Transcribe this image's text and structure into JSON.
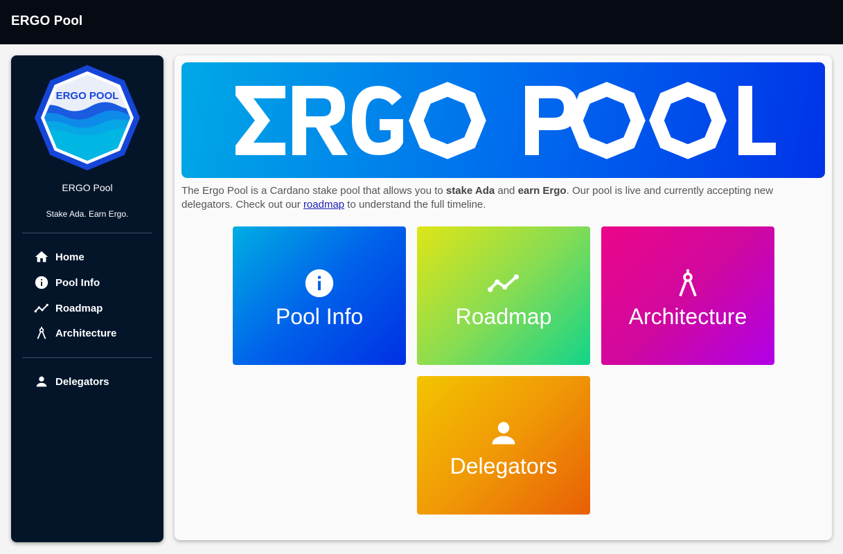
{
  "app": {
    "title": "ERGO Pool"
  },
  "sidebar": {
    "logo_text": "ERGO POOL",
    "title": "ERGO Pool",
    "tagline": "Stake Ada. Earn Ergo.",
    "nav": [
      {
        "label": "Home",
        "icon": "home-icon"
      },
      {
        "label": "Pool Info",
        "icon": "info-icon"
      },
      {
        "label": "Roadmap",
        "icon": "timeline-icon"
      },
      {
        "label": "Architecture",
        "icon": "compass-icon"
      }
    ],
    "nav2": [
      {
        "label": "Delegators",
        "icon": "person-icon"
      }
    ]
  },
  "main": {
    "hero_text": "ERGO POOL",
    "intro": {
      "p1": "The Ergo Pool is a Cardano stake pool that allows you to ",
      "b1": "stake Ada",
      "p2": " and ",
      "b2": "earn Ergo",
      "p3": ". Our pool is live and currently accepting new delegators. Check out our ",
      "link": "roadmap",
      "p4": " to understand the full timeline."
    },
    "cards": [
      {
        "label": "Pool Info",
        "icon": "info-icon"
      },
      {
        "label": "Roadmap",
        "icon": "timeline-icon"
      },
      {
        "label": "Architecture",
        "icon": "compass-icon"
      },
      {
        "label": "Delegators",
        "icon": "person-icon"
      }
    ]
  },
  "colors": {
    "topbar": "#050a13",
    "sidebar": "#04152a",
    "card_pool_info": "#0062ea",
    "card_roadmap": "#88dc52",
    "card_architecture": "#d0089f",
    "card_delegators": "#f09806"
  }
}
